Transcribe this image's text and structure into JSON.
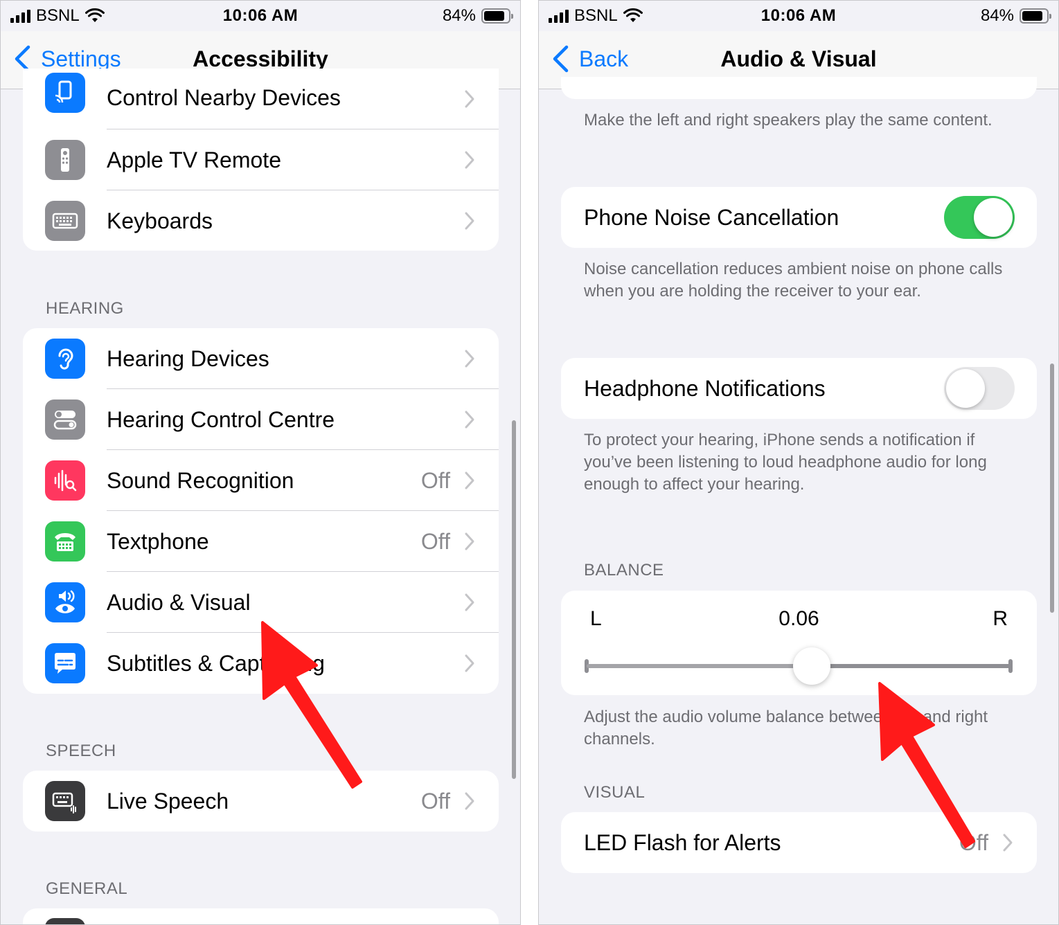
{
  "status_bar": {
    "carrier": "BSNL",
    "time": "10:06 AM",
    "battery": "84%"
  },
  "left": {
    "nav": {
      "back_label": "Settings",
      "title": "Accessibility"
    },
    "top_group": [
      {
        "label": "Control Nearby Devices",
        "icon": "remote-devices-icon",
        "color": "#0a7aff"
      },
      {
        "label": "Apple TV Remote",
        "icon": "tv-remote-icon",
        "color": "#8e8e93"
      },
      {
        "label": "Keyboards",
        "icon": "keyboard-icon",
        "color": "#8e8e93"
      }
    ],
    "hearing_header": "HEARING",
    "hearing_group": [
      {
        "label": "Hearing Devices",
        "value": "",
        "icon": "ear-icon",
        "color": "#0a7aff"
      },
      {
        "label": "Hearing Control Centre",
        "value": "",
        "icon": "toggles-icon",
        "color": "#8e8e93"
      },
      {
        "label": "Sound Recognition",
        "value": "Off",
        "icon": "waveform-search-icon",
        "color": "#ff375f"
      },
      {
        "label": "Textphone",
        "value": "Off",
        "icon": "textphone-icon",
        "color": "#34c759"
      },
      {
        "label": "Audio & Visual",
        "value": "",
        "icon": "speaker-eye-icon",
        "color": "#0a7aff"
      },
      {
        "label": "Subtitles & Captioning",
        "value": "",
        "icon": "caption-bubble-icon",
        "color": "#0a7aff"
      }
    ],
    "speech_header": "SPEECH",
    "speech_group": [
      {
        "label": "Live Speech",
        "value": "Off",
        "icon": "live-speech-keyboard-icon",
        "color": "#3a3a3c"
      }
    ],
    "general_header": "GENERAL"
  },
  "right": {
    "nav": {
      "back_label": "Back",
      "title": "Audio & Visual"
    },
    "mono_footer": "Make the left and right speakers play the same content.",
    "noise_cancellation": {
      "label": "Phone Noise Cancellation",
      "on": true
    },
    "noise_footer": "Noise cancellation reduces ambient noise on phone calls when you are holding the receiver to your ear.",
    "headphone_notifications": {
      "label": "Headphone Notifications",
      "on": false
    },
    "headphone_footer": "To protect your hearing, iPhone sends a notification if you’ve been listening to loud headphone audio for long enough to affect your hearing.",
    "balance_header": "BALANCE",
    "balance": {
      "left_label": "L",
      "right_label": "R",
      "value": "0.06",
      "min": -1,
      "max": 1,
      "position": 0.06
    },
    "balance_footer": "Adjust the audio volume balance between left and right channels.",
    "visual_header": "VISUAL",
    "led_flash": {
      "label": "LED Flash for Alerts",
      "value": "Off"
    }
  },
  "colors": {
    "accent": "#0a7aff",
    "toggle_on": "#34c759",
    "annotation_arrow": "#ff1a1a"
  }
}
